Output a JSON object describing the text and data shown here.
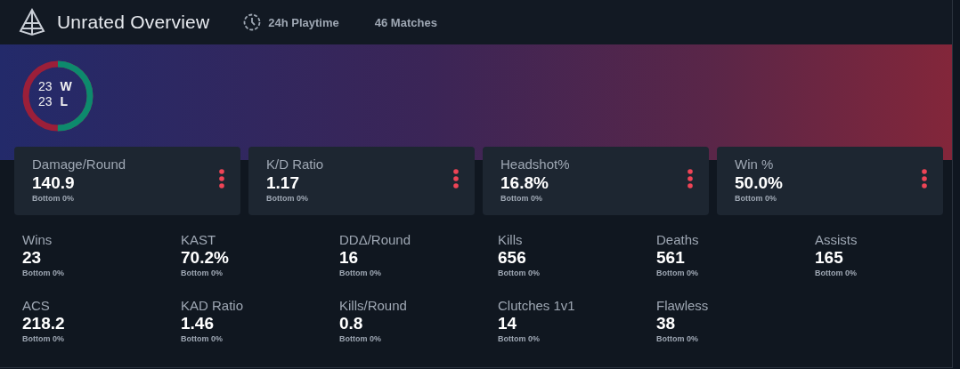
{
  "header": {
    "title": "Unrated Overview",
    "playtime": "24h Playtime",
    "matches": "46 Matches"
  },
  "record": {
    "wins": "23",
    "wins_label": "W",
    "losses": "23",
    "losses_label": "L",
    "level": 0.5
  },
  "cards": [
    {
      "label": "Damage/Round",
      "value": "140.9",
      "rank": "Bottom 0%"
    },
    {
      "label": "K/D Ratio",
      "value": "1.17",
      "rank": "Bottom 0%"
    },
    {
      "label": "Headshot%",
      "value": "16.8%",
      "rank": "Bottom 0%"
    },
    {
      "label": "Win %",
      "value": "50.0%",
      "rank": "Bottom 0%"
    }
  ],
  "stats": [
    {
      "label": "Wins",
      "value": "23",
      "rank": "Bottom 0%"
    },
    {
      "label": "KAST",
      "value": "70.2%",
      "rank": "Bottom 0%"
    },
    {
      "label": "DDΔ/Round",
      "value": "16",
      "rank": "Bottom 0%"
    },
    {
      "label": "Kills",
      "value": "656",
      "rank": "Bottom 0%"
    },
    {
      "label": "Deaths",
      "value": "561",
      "rank": "Bottom 0%"
    },
    {
      "label": "Assists",
      "value": "165",
      "rank": "Bottom 0%"
    },
    {
      "label": "ACS",
      "value": "218.2",
      "rank": "Bottom 0%"
    },
    {
      "label": "KAD Ratio",
      "value": "1.46",
      "rank": "Bottom 0%"
    },
    {
      "label": "Kills/Round",
      "value": "0.8",
      "rank": "Bottom 0%"
    },
    {
      "label": "Clutches 1v1",
      "value": "14",
      "rank": "Bottom 0%"
    },
    {
      "label": "Flawless",
      "value": "38",
      "rank": "Bottom 0%"
    }
  ]
}
